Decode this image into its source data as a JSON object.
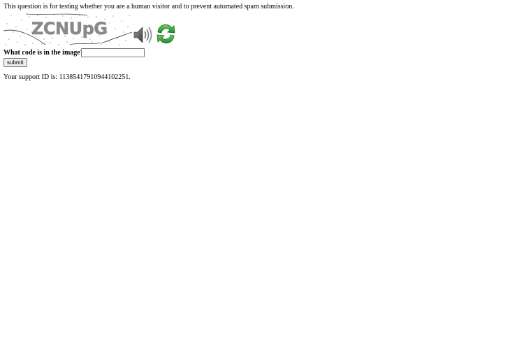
{
  "page": {
    "intro_text": "This question is for testing whether you are a human visitor and to prevent automated spam submission.",
    "captcha": {
      "code_text": "ZCNUpG",
      "audio_icon": "speaker-icon",
      "refresh_icon": "refresh-icon"
    },
    "form": {
      "question_label": "What code is in the image?",
      "code_value": "",
      "submit_label": "submit"
    },
    "support_prefix": "Your support ID is: ",
    "support_id": "11385417910944102251",
    "support_suffix": "."
  },
  "colors": {
    "refresh_green": "#3aa33a",
    "refresh_dark": "#1f6e1f",
    "speaker_gray": "#555555",
    "captcha_text": "#8a8a8a"
  }
}
